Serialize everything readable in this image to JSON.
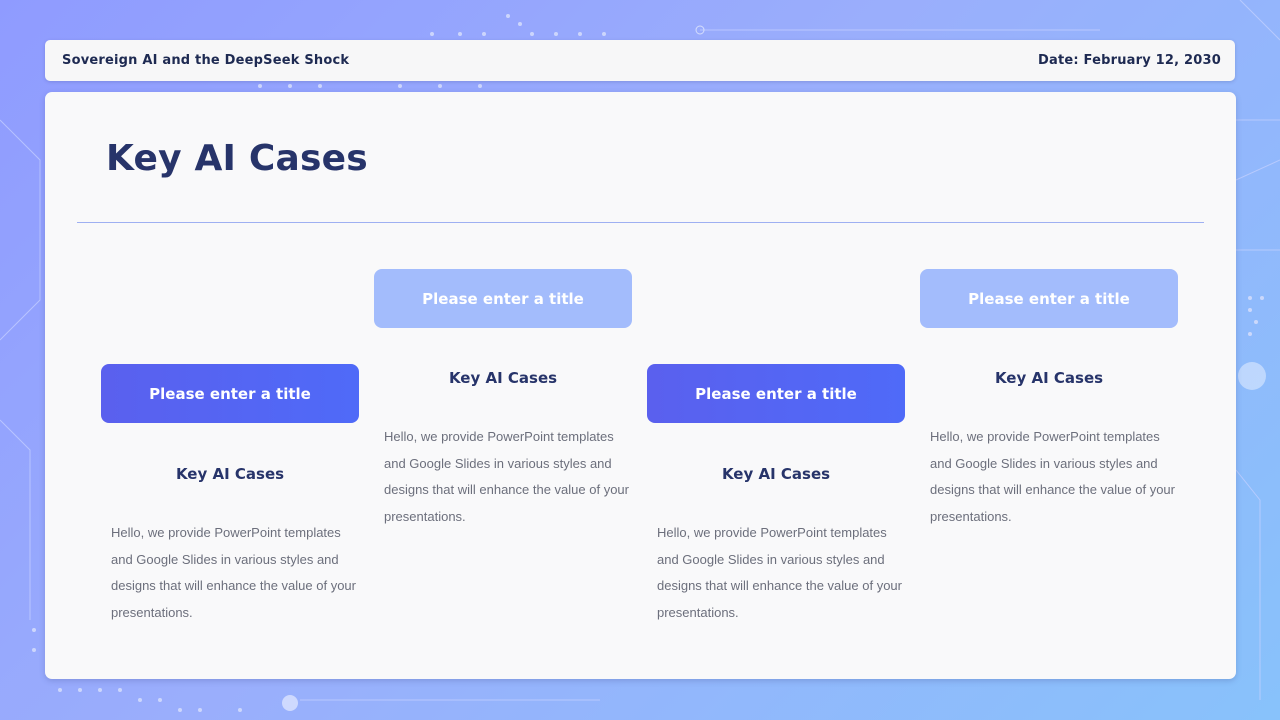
{
  "header": {
    "left_text": "Sovereign  AI and the DeepSeek  Shock",
    "right_text": "Date: February  12, 2030"
  },
  "main": {
    "title": "Key AI Cases"
  },
  "cards": [
    {
      "box_label": "Please enter a title",
      "heading": "Key AI Cases",
      "body": "Hello, we provide PowerPoint templates and Google Slides in various styles and designs that will enhance the value of your presentations."
    },
    {
      "box_label": "Please enter a title",
      "heading": "Key AI Cases",
      "body": "Hello, we provide PowerPoint templates and Google Slides in various styles and designs that will enhance the value of your presentations."
    },
    {
      "box_label": "Please enter a title",
      "heading": "Key AI Cases",
      "body": "Hello, we provide PowerPoint templates and Google Slides in various styles and designs that will enhance the value of your presentations."
    },
    {
      "box_label": "Please enter a title",
      "heading": "Key AI Cases",
      "body": "Hello, we provide PowerPoint templates and Google Slides in various styles and designs that will enhance the value of your presentations."
    }
  ],
  "colors": {
    "accent_dark": "#5665f2",
    "accent_light": "#a3bcfc",
    "title_text": "#27346a"
  }
}
